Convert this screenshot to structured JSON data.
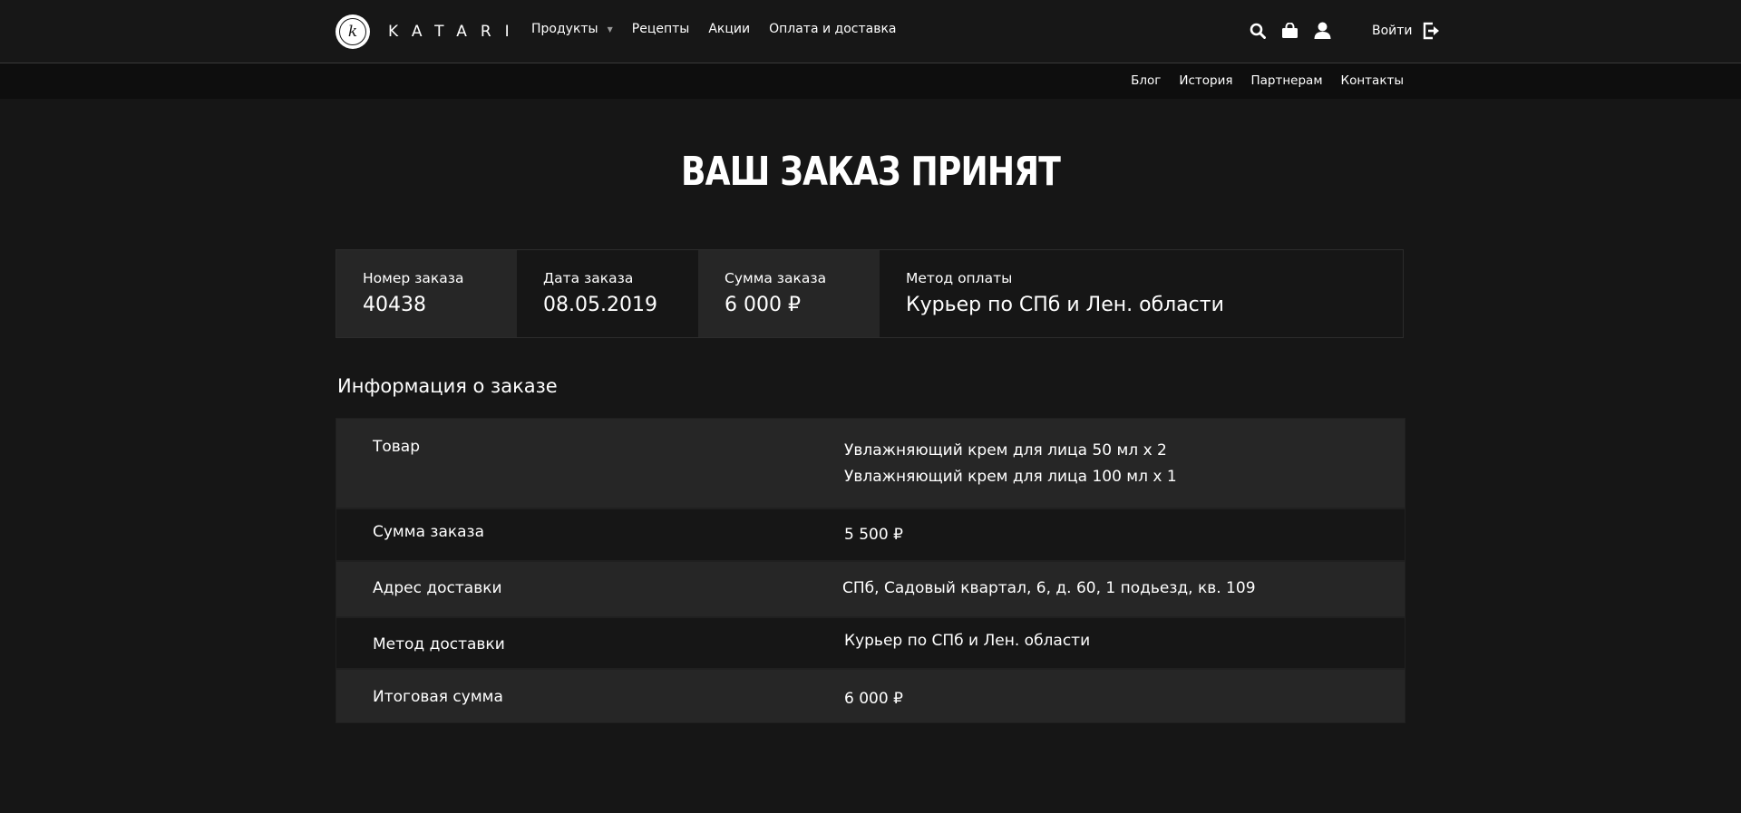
{
  "brand": {
    "name": "KATARI",
    "logo_letter": "k"
  },
  "main_nav": [
    {
      "label": "Продукты",
      "has_dropdown": true
    },
    {
      "label": "Рецепты"
    },
    {
      "label": "Акции"
    },
    {
      "label": "Оплата и доставка"
    }
  ],
  "header_icons": [
    "search-icon",
    "shopping-bag-icon",
    "user-icon"
  ],
  "login": {
    "label": "Войти",
    "icon": "sign-in-icon"
  },
  "secondary_nav": [
    "Блог",
    "История",
    "Партнерам",
    "Контакты"
  ],
  "page_title": "ВАШ ЗАКАЗ ПРИНЯТ",
  "summary": [
    {
      "label": "Номер заказа",
      "value": "40438"
    },
    {
      "label": "Дата заказа",
      "value": "08.05.2019"
    },
    {
      "label": "Сумма заказа",
      "value": "6 000 ₽"
    },
    {
      "label": "Метод оплаты",
      "value": "Курьер по СПб и Лен. области"
    }
  ],
  "info": {
    "title": "Информация о заказе",
    "rows": [
      {
        "label": "Товар",
        "values": [
          "Увлажняющий крем для лица 50 мл x 2",
          "Увлажняющий крем для лица 100 мл x 1"
        ]
      },
      {
        "label": "Сумма заказа",
        "values": [
          "5 500 ₽"
        ]
      },
      {
        "label": "Адрес доставки",
        "values": [
          "СПб, Садовый квартал, 6, д. 60, 1 подьезд, кв. 109"
        ]
      },
      {
        "label": "Метод доставки",
        "values": [
          "Курьер по СПб и Лен. области"
        ]
      },
      {
        "label": "Итоговая сумма",
        "values": [
          "6 000 ₽"
        ]
      }
    ]
  },
  "colors": {
    "background": "#161616",
    "header": "#171717",
    "subheader": "#0e0e0e",
    "shaded_row": "#262626",
    "text": "#ffffff"
  }
}
